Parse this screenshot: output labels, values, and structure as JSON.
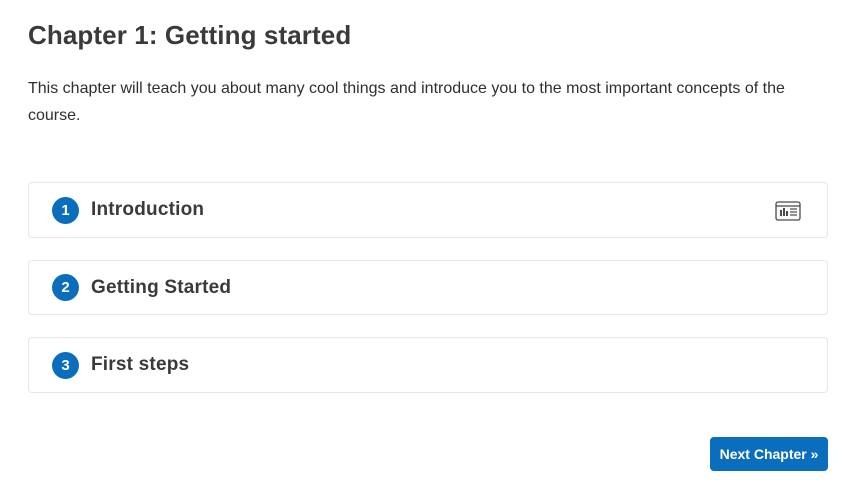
{
  "chapter": {
    "title": "Chapter 1: Getting started",
    "description": "This chapter will teach you about many cool things and introduce you to the most important concepts of the course."
  },
  "lessons": [
    {
      "number": "1",
      "title": "Introduction",
      "icon": "slideshow-icon"
    },
    {
      "number": "2",
      "title": "Getting Started"
    },
    {
      "number": "3",
      "title": "First steps"
    }
  ],
  "navigation": {
    "next_label": "Next Chapter »"
  },
  "colors": {
    "accent": "#0a6ebd",
    "text": "#3a3a3a",
    "border": "#e6e6e6"
  }
}
